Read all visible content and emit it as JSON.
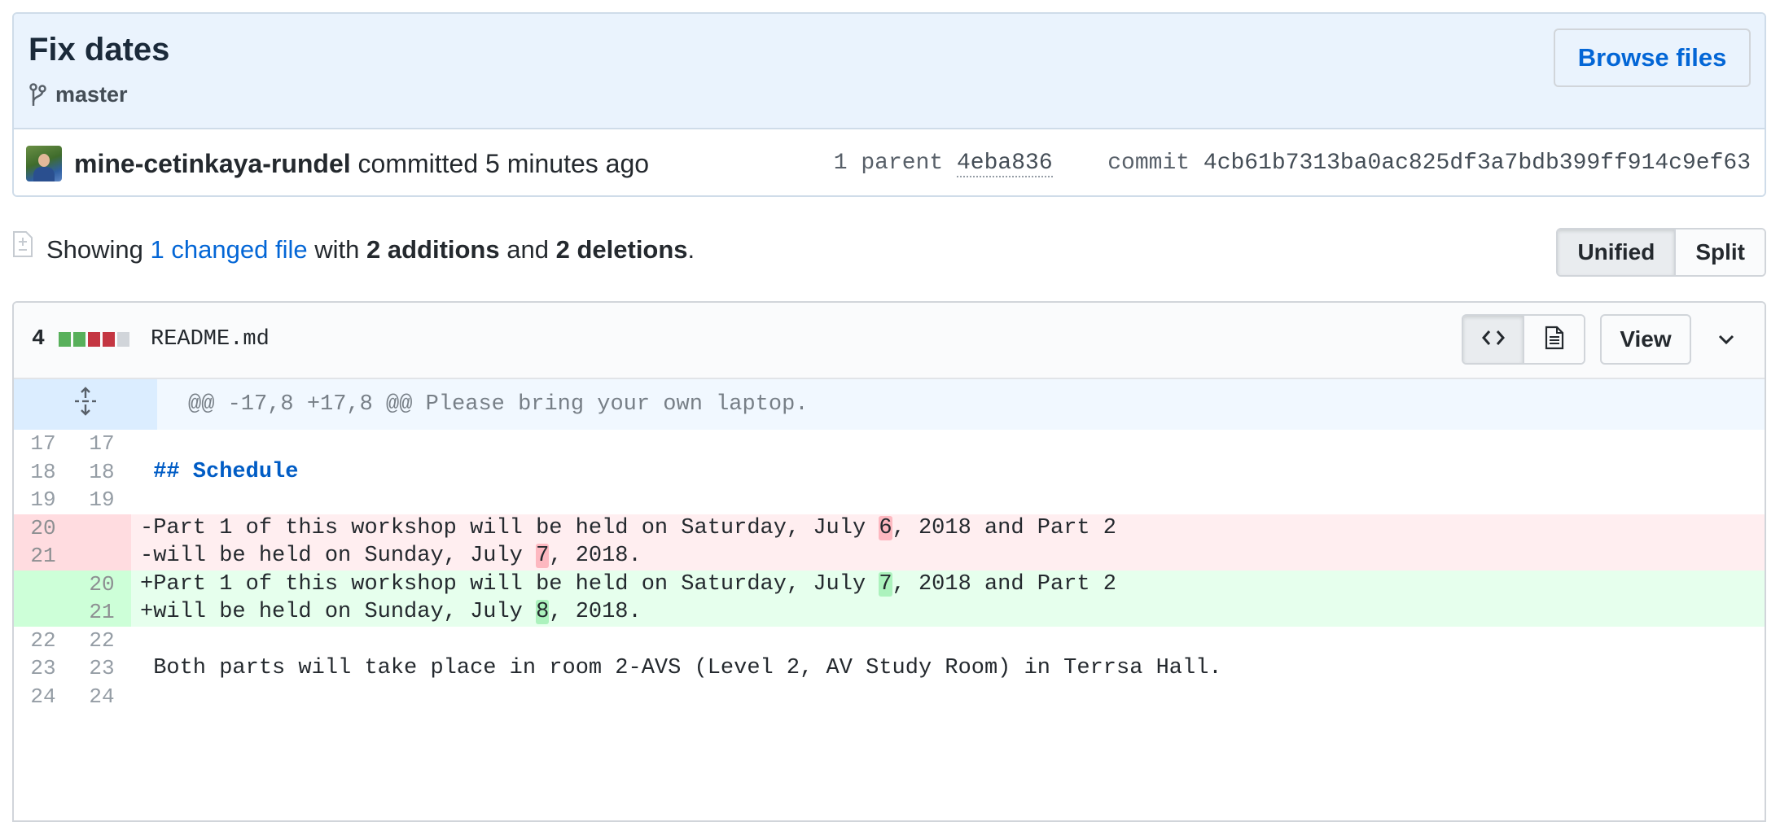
{
  "commit": {
    "title": "Fix dates",
    "branch": "master",
    "browse_label": "Browse files",
    "author": "mine-cetinkaya-rundel",
    "committed_text": "committed 5 minutes ago",
    "parent_label": "1 parent",
    "parent_sha": "4eba836",
    "commit_label": "commit",
    "commit_sha": "4cb61b7313ba0ac825df3a7bdb399ff914c9ef63"
  },
  "toc": {
    "showing": "Showing",
    "changed_link": "1 changed file",
    "with": "with",
    "additions": "2 additions",
    "and": "and",
    "deletions": "2 deletions",
    "period": "."
  },
  "view_toggle": {
    "unified": "Unified",
    "split": "Split"
  },
  "file": {
    "diffstat": "4",
    "diffstat_blocks": [
      "add",
      "add",
      "del",
      "del",
      "neutral"
    ],
    "name": "README.md",
    "view_label": "View"
  },
  "diff": {
    "hunk_header": "@@ -17,8 +17,8 @@ Please bring your own laptop.",
    "rows": [
      {
        "type": "context",
        "old": "17",
        "new": "17",
        "text": ""
      },
      {
        "type": "context",
        "old": "18",
        "new": "18",
        "text": "## Schedule"
      },
      {
        "type": "context",
        "old": "19",
        "new": "19",
        "text": ""
      },
      {
        "type": "del",
        "old": "20",
        "new": "",
        "pre": "-Part 1 of this workshop will be held on Saturday, July ",
        "mark": "6",
        "post": ", 2018 and Part 2"
      },
      {
        "type": "del",
        "old": "21",
        "new": "",
        "pre": "-will be held on Sunday, July ",
        "mark": "7",
        "post": ", 2018."
      },
      {
        "type": "add",
        "old": "",
        "new": "20",
        "pre": "+Part 1 of this workshop will be held on Saturday, July ",
        "mark": "7",
        "post": ", 2018 and Part 2"
      },
      {
        "type": "add",
        "old": "",
        "new": "21",
        "pre": "+will be held on Sunday, July ",
        "mark": "8",
        "post": ", 2018."
      },
      {
        "type": "context",
        "old": "22",
        "new": "22",
        "text": ""
      },
      {
        "type": "context",
        "old": "23",
        "new": "23",
        "text": "Both parts will take place in room 2-AVS (Level 2, AV Study Room) in Terrsa Hall."
      },
      {
        "type": "context",
        "old": "24",
        "new": "24",
        "text": ""
      }
    ]
  },
  "icons": {
    "branch": "git-branch-icon",
    "file_diff": "file-diff-icon",
    "code": "code-icon",
    "rich_diff": "file-icon",
    "expand": "unfold-icon",
    "chevron": "chevron-down-icon"
  }
}
